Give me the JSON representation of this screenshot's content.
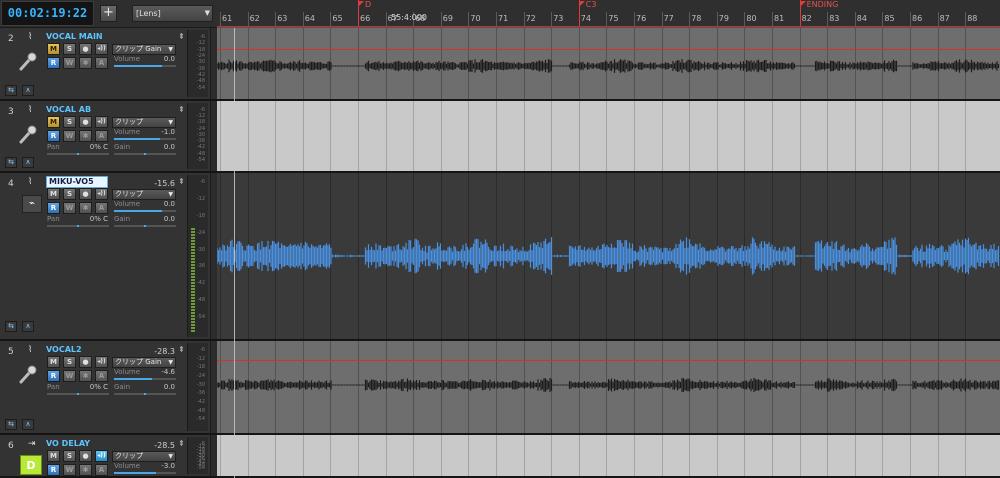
{
  "transport": {
    "time": "00:02:19:22",
    "add_label": "+",
    "lens_label": "[Lens]"
  },
  "ruler": {
    "bars": [
      "61",
      "62",
      "63",
      "64",
      "65",
      "66",
      "67",
      "68",
      "69",
      "70",
      "71",
      "72",
      "73",
      "74",
      "75",
      "76",
      "77",
      "78",
      "79",
      "80",
      "81",
      "82",
      "83",
      "84",
      "85",
      "86",
      "87",
      "88"
    ],
    "now_label": "55:4:000",
    "markers": [
      {
        "label": "D",
        "bar": 66
      },
      {
        "label": "C3",
        "bar": 74
      },
      {
        "label": "ENDING",
        "bar": 82
      }
    ]
  },
  "tracks": [
    {
      "num": "2",
      "name": "VOCAL MAIN",
      "db": "",
      "clip_mode": "クリップ Gain",
      "volume_label": "Volume",
      "volume": "0.0",
      "volume_level": 0.78,
      "pan_label": "",
      "pan": "",
      "gain_label": "",
      "gain": "",
      "m_active": true,
      "lane_style": "gray"
    },
    {
      "num": "3",
      "name": "VOCAL AB",
      "db": "",
      "clip_mode": "クリップ",
      "volume_label": "Volume",
      "volume": "-1.0",
      "volume_level": 0.74,
      "pan_label": "Pan",
      "pan": "0% C",
      "gain_label": "Gain",
      "gain": "0.0",
      "m_active": true,
      "lane_style": "light"
    },
    {
      "num": "4",
      "name": "MIKU-VO5",
      "db": "-15.6",
      "clip_mode": "クリップ",
      "volume_label": "Volume",
      "volume": "0.0",
      "volume_level": 0.78,
      "pan_label": "Pan",
      "pan": "0% C",
      "gain_label": "Gain",
      "gain": "0.0",
      "m_active": false,
      "lane_style": "dark"
    },
    {
      "num": "5",
      "name": "VOCAL2",
      "db": "-28.3",
      "clip_mode": "クリップ Gain",
      "volume_label": "Volume",
      "volume": "-4.6",
      "volume_level": 0.62,
      "pan_label": "Pan",
      "pan": "0% C",
      "gain_label": "Gain",
      "gain": "0.0",
      "m_active": false,
      "lane_style": "gray"
    },
    {
      "num": "6",
      "name": "VO DELAY",
      "db": "-28.5",
      "clip_mode": "クリップ",
      "volume_label": "Volume",
      "volume": "-3.0",
      "volume_level": 0.68,
      "pan_label": "",
      "pan": "",
      "gain_label": "",
      "gain": "",
      "m_active": false,
      "lane_style": "light"
    }
  ],
  "buttons": {
    "m": "M",
    "s": "S",
    "r": "R",
    "w": "W",
    "a": "A"
  },
  "badge_d": "D",
  "colors": {
    "accent": "#39b4ff",
    "marker": "#e03a3a",
    "wave_blue": "#4a90e0",
    "wave_dark": "#1c1c1c",
    "solo_yellow": "#e9c35a"
  },
  "meter_scale": [
    "-6",
    "-12",
    "-18",
    "-24",
    "-30",
    "-36",
    "-42",
    "-48",
    "-54"
  ]
}
